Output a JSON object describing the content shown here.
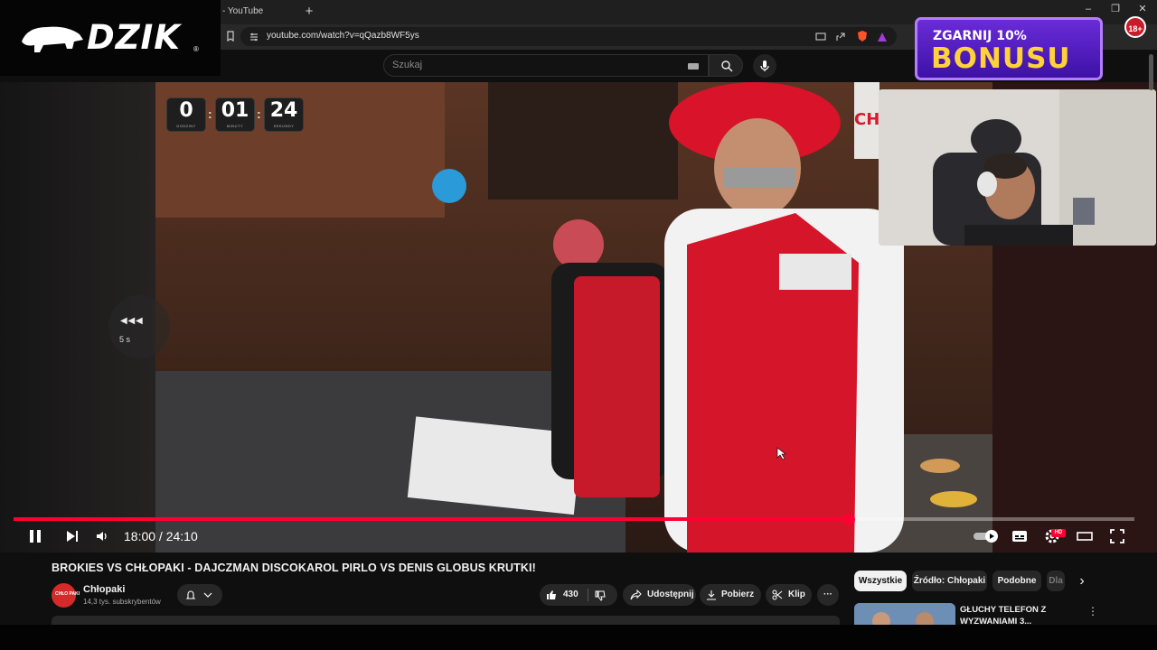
{
  "browser": {
    "tab_title": "- YouTube",
    "new_tab": "+",
    "url": "youtube.com/watch?v=qQazb8WF5ys",
    "window_controls": {
      "minimize": "–",
      "maximize": "❐",
      "close": "✕"
    }
  },
  "overlay": {
    "logo_text": "DZIK",
    "logo_mark": "®",
    "bonus_line1": "ZGARNIJ 10%",
    "bonus_line2": "BONUSU",
    "age_badge": "18+",
    "timer": [
      {
        "value": "0",
        "unit": "GODZINY"
      },
      {
        "value": "01",
        "unit": "MINUTY"
      },
      {
        "value": "24",
        "unit": "SEKUNDY"
      }
    ],
    "video_sign": "CH"
  },
  "search": {
    "placeholder": "Szukaj"
  },
  "player": {
    "seek_label": "5 s",
    "current_time": "18:00",
    "duration": "24:10",
    "time_display": "18:00 / 24:10",
    "progress": 0.745,
    "hd_badge": "HD"
  },
  "video": {
    "title": "BROKIES VS CHŁOPAKI - DAJCZMAN DISCOKAROL PIRLO VS DENIS GLOBUS KRUTKI!",
    "channel_name": "Chłopaki",
    "channel_avatar_text": "CHŁO PAKI",
    "subscribers": "14,3 tys. subskrybentów",
    "likes": "430",
    "share_label": "Udostępnij",
    "download_label": "Pobierz",
    "clip_label": "Klip",
    "more_label": "···"
  },
  "sidebar": {
    "chips": [
      "Wszystkie",
      "Źródło: Chłopaki",
      "Podobne",
      "Dla"
    ],
    "next_chip": "›",
    "recommendation_title": "GŁUCHY TELEFON Z WYZWANIAMI 3..."
  },
  "colors": {
    "accent": "#ff0033",
    "brand_bonus": "#ffd23a",
    "bonus_bg": "#5a22cc"
  }
}
